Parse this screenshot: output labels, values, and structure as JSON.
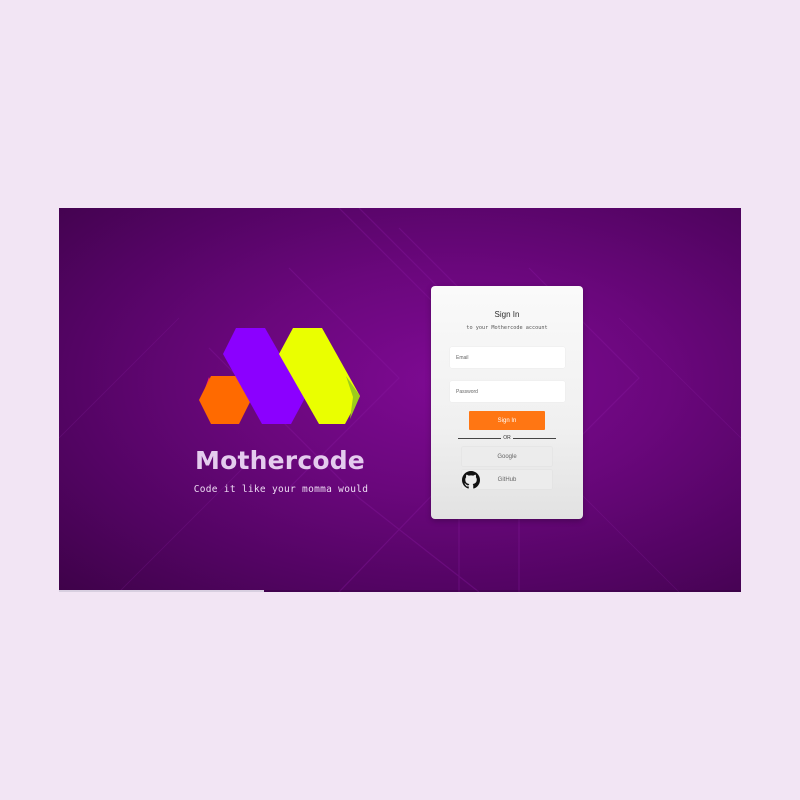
{
  "brand": {
    "name": "Mothercode",
    "tagline": "Code it like your momma would",
    "logo_colors": {
      "purple": "#8b00ff",
      "yellow": "#eaff00",
      "orange": "#ff6a00",
      "pink": "#ff1e6e",
      "green": "#9ccc1c"
    }
  },
  "signin": {
    "title": "Sign In",
    "subtitle": "to your Mothercode account",
    "email_placeholder": "Email",
    "password_placeholder": "Password",
    "submit_label": "Sign In",
    "divider_label": "OR",
    "google_label": "Google",
    "github_label": "GitHub"
  },
  "progress": {
    "fraction": 0.3
  },
  "icons": {
    "github": "github-icon"
  },
  "colors": {
    "accent": "#ff7613",
    "background": "#6a077c"
  }
}
